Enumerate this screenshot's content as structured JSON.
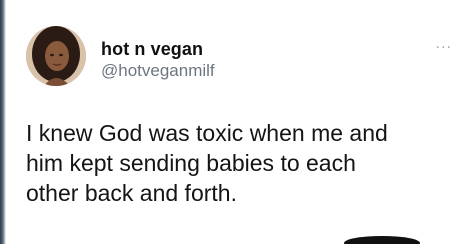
{
  "tweet": {
    "author": {
      "display_name": "hot n vegan",
      "handle": "@hotveganmilf",
      "avatar_icon": "profile-photo"
    },
    "more_icon": "more-options-icon",
    "more_label": "...",
    "text_lines": [
      "I knew God was toxic when me and",
      "him kept sending babies to each",
      "other back and forth."
    ]
  },
  "colors": {
    "name": "#111111",
    "handle": "#6d7680",
    "text": "#141414",
    "background": "#ffffff"
  }
}
